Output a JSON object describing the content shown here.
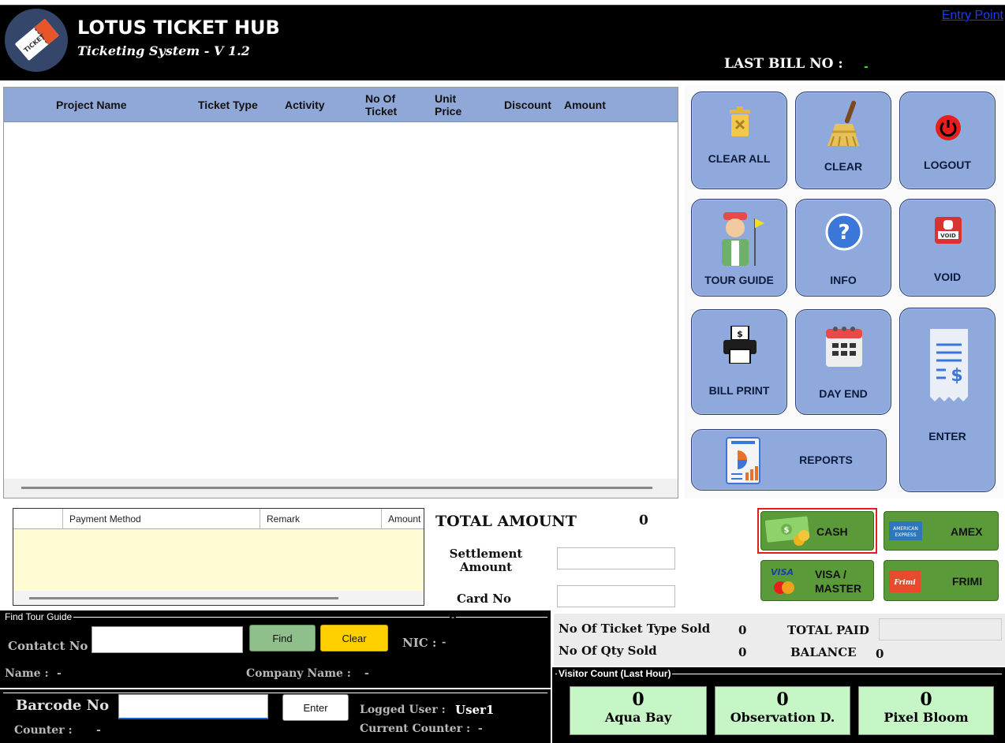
{
  "header": {
    "title": "LOTUS TICKET HUB",
    "subtitle": "Ticketing System - V 1.2",
    "entry_link": "Entry Point",
    "last_bill_label": "LAST BILL NO :",
    "last_bill_value": "-",
    "logo_text": "TICKET"
  },
  "ticket_table": {
    "columns": [
      {
        "label": "Project Name"
      },
      {
        "label": "Ticket Type"
      },
      {
        "label": "Activity"
      },
      {
        "label": "No Of Ticket"
      },
      {
        "label": "Unit Price"
      },
      {
        "label": "Discount"
      },
      {
        "label": "Amount"
      }
    ]
  },
  "actions": {
    "clear_all": "CLEAR ALL",
    "clear": "CLEAR",
    "logout": "LOGOUT",
    "tour_guide": "TOUR GUIDE",
    "info": "INFO",
    "void": "VOID",
    "bill_print": "BILL PRINT",
    "day_end": "DAY END",
    "enter": "ENTER",
    "reports": "REPORTS"
  },
  "payment_table": {
    "columns": [
      "Payment Method",
      "Remark",
      "Amount"
    ]
  },
  "totals": {
    "total_amount_label": "TOTAL AMOUNT",
    "total_amount_value": "0",
    "settlement_label": "Settlement Amount",
    "settlement_value": "",
    "card_no_label": "Card No",
    "card_no_value": ""
  },
  "pay_methods": {
    "cash": "CASH",
    "amex": "AMEX",
    "visa_master": "VISA / MASTER",
    "frimi": "FRIMI",
    "selected": "cash"
  },
  "tour_guide": {
    "legend": "Find Tour Guide",
    "dash": "-",
    "contact_label": "Contatct No",
    "contact_value": "",
    "find_button": "Find",
    "clear_button": "Clear",
    "nic_label": "NIC :",
    "nic_value": "-",
    "name_label": "Name :",
    "name_value": "-",
    "company_label": "Company Name :",
    "company_value": "-"
  },
  "barcode": {
    "label": "Barcode No",
    "value": "",
    "enter_button": "Enter",
    "logged_user_label": "Logged User :",
    "logged_user_value": "User1",
    "counter_label": "Counter :",
    "counter_value": "-",
    "current_counter_label": "Current Counter :",
    "current_counter_value": "-"
  },
  "stats": {
    "type_sold_label": "No Of Ticket Type Sold",
    "type_sold_value": "0",
    "qty_sold_label": "No Of Qty Sold",
    "qty_sold_value": "0",
    "total_paid_label": "TOTAL PAID",
    "total_paid_value": "",
    "balance_label": "BALANCE",
    "balance_value": "0"
  },
  "visitor": {
    "legend": "Visitor Count (Last Hour)",
    "items": [
      {
        "count": "0",
        "name": "Aqua Bay"
      },
      {
        "count": "0",
        "name": "Observation D."
      },
      {
        "count": "0",
        "name": "Pixel Bloom"
      }
    ]
  },
  "colors": {
    "tile": "#8fa9dc",
    "pay_green": "#5b9a38",
    "selected_border": "#e02020",
    "visitor_bg": "#c6f5c6"
  }
}
